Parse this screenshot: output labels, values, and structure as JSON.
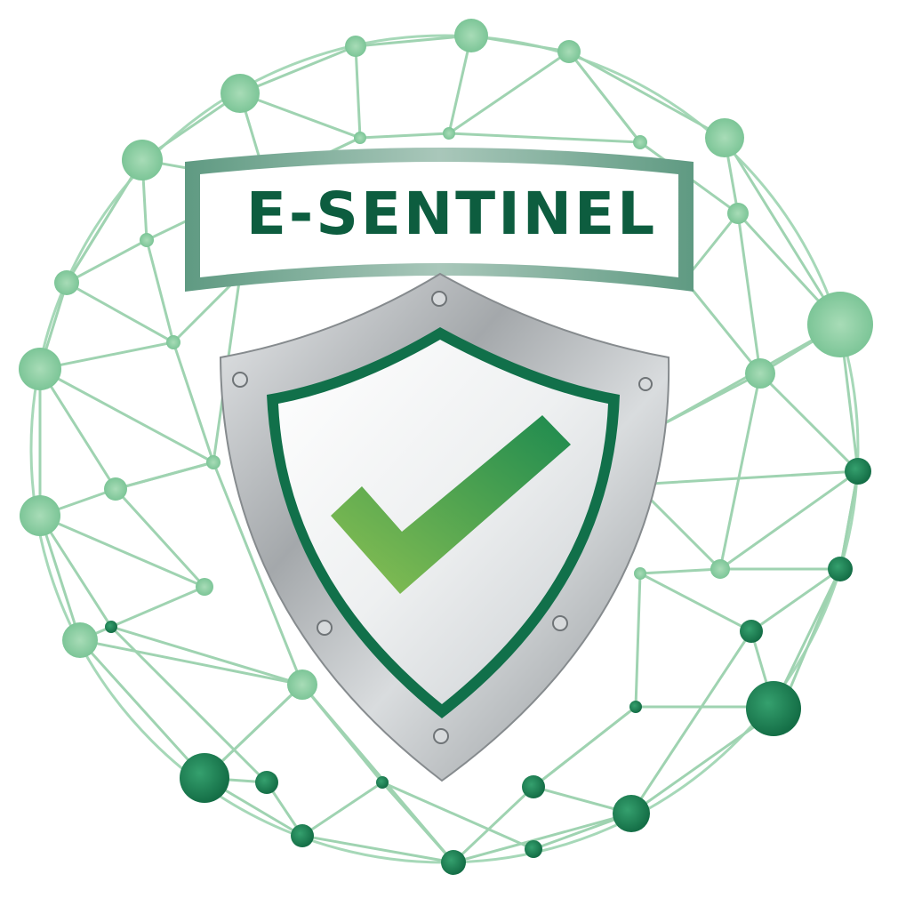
{
  "logo": {
    "wordmark": "E-SENTINEL",
    "colors": {
      "network_light": "#8fd0a6",
      "network_dark": "#1a7a50",
      "wordmark_text": "#0d5d3f",
      "banner_border": "#5f9a82",
      "shield_frame": "#9fa3a6",
      "shield_inner_border": "#11704a",
      "checkmark_start": "#8cc152",
      "checkmark_end": "#1d8a4f"
    },
    "icons": [
      "network-globe-icon",
      "shield-icon",
      "checkmark-icon",
      "rivet-icon"
    ]
  }
}
